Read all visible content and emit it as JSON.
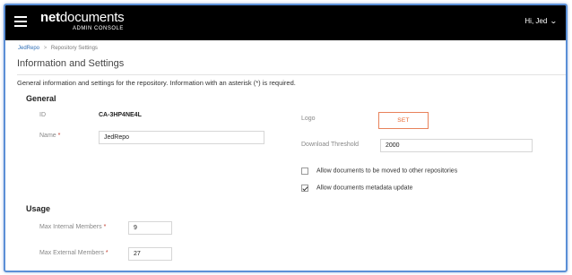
{
  "header": {
    "brand_net": "net",
    "brand_documents": "documents",
    "brand_sub": "ADMIN CONSOLE",
    "user_menu": "Hi, Jed"
  },
  "breadcrumb": {
    "root": "JedRepo",
    "separator": ">",
    "current": "Repository Settings"
  },
  "page": {
    "title": "Information and Settings",
    "intro": "General information and settings for the repository. Information with an asterisk (*) is required."
  },
  "general": {
    "heading": "General",
    "id_label": "ID",
    "id_value": "CA-3HP4NE4L",
    "name_label": "Name",
    "name_value": "JedRepo",
    "logo_label": "Logo",
    "logo_button": "SET",
    "download_threshold_label": "Download Threshold",
    "download_threshold_value": "2000",
    "allow_move_label": "Allow documents to be moved to other repositories",
    "allow_move_checked": false,
    "allow_metadata_label": "Allow documents metadata update",
    "allow_metadata_checked": true
  },
  "usage": {
    "heading": "Usage",
    "max_internal_label": "Max Internal Members",
    "max_internal_value": "9",
    "max_external_label": "Max External Members",
    "max_external_value": "27"
  },
  "required_marker": "*",
  "colors": {
    "topbar": "#000000",
    "accent_orange": "#e8642c",
    "required_red": "#c0392b",
    "link_blue": "#2d6db5"
  }
}
